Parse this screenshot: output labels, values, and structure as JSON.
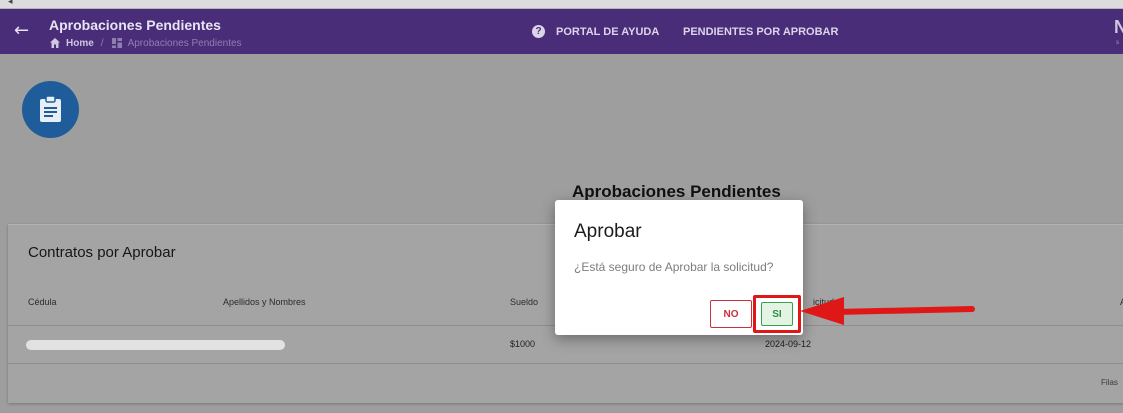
{
  "window": {
    "collapse_glyph": "◂"
  },
  "appbar": {
    "title": "Aprobaciones Pendientes",
    "back_icon": "arrow-left-icon",
    "breadcrumb": {
      "home": "Home",
      "separator": "/",
      "current": "Aprobaciones Pendientes"
    },
    "nav": [
      {
        "label": "PORTAL DE AYUDA",
        "icon": "help-circle-icon"
      },
      {
        "label": "PENDIENTES POR APROBAR"
      }
    ],
    "brand_partial": "N",
    "background": "#4a2d79"
  },
  "fab": {
    "icon": "clipboard-icon",
    "color": "#1f5d9a"
  },
  "page": {
    "heading": "Aprobaciones Pendientes"
  },
  "card": {
    "title": "Contratos por Aprobar",
    "columns": [
      "Cédula",
      "Apellidos y Nombres",
      "Sueldo",
      "icitud",
      "A"
    ],
    "rows": [
      {
        "cedula_nombres": "",
        "sueldo": "$1000",
        "fecha": "2024-09-12"
      }
    ],
    "footer": "Filas"
  },
  "dialog": {
    "title": "Aprobar",
    "message": "¿Está seguro de Aprobar la solicitud?",
    "no_label": "NO",
    "si_label": "SI",
    "no_color": "#c9323c",
    "si_color": "#37a04a"
  },
  "annotation": {
    "color": "#e01717"
  }
}
